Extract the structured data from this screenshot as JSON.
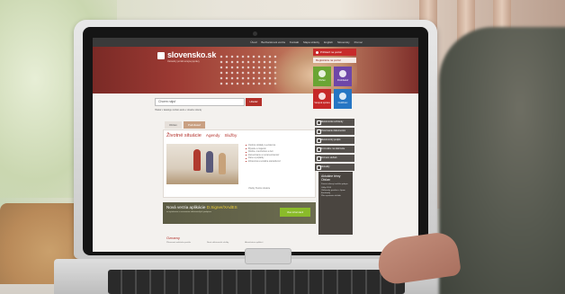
{
  "site": {
    "top_nav": [
      "Úvod",
      "Bezbariérová verzia",
      "Kontakt",
      "Mapa stránky",
      "English",
      "Slovensky",
      "Pomoc"
    ],
    "logo": {
      "name": "slovensko.sk",
      "tagline": "Ústredný portál verejnej správy"
    },
    "login_label": "Prihlásiť na portál",
    "register_label": "Registrácia na portál",
    "tiles": [
      {
        "label": "Občan",
        "color": "#6aa534"
      },
      {
        "label": "Podnikateľ",
        "color": "#6e46a8"
      },
      {
        "label": "Verejná správa",
        "color": "#c62828"
      },
      {
        "label": "Cudzinec",
        "color": "#2676c4"
      }
    ],
    "search": {
      "placeholder": "Chcem nájsť",
      "button": "Hľadať",
      "sub": "Hľadať v katalógu služieb alebo v obsahu stránky"
    },
    "tabs": [
      "Občan",
      "Podnikateľ"
    ],
    "headline": [
      "Životné situácie",
      "Agendy",
      "Služby"
    ],
    "life_situations": [
      "Osobné doklady a evidencia",
      "Bývanie a majetok",
      "Rodina, manželstvo a deti",
      "Zamestnanie a nezamestnanosť",
      "Dane a poplatky",
      "Zdravotná a sociálna starostlivosť"
    ],
    "life_more": "Všetky životné situácie",
    "side_links": [
      "Elektronické schránky",
      "Overovanie dokumentov",
      "Elektronický podpis",
      "Formuláre na stiahnutie",
      "Zoznam služieb",
      "Aktuality"
    ],
    "news_box": {
      "title": "Aktuálne témy Občan",
      "items": [
        "Zmena adresy trvalého pobytu",
        "Voľby 2014",
        "Občiansky preukaz s čipom",
        "Eurofondy",
        "Plán spustenia služieb"
      ]
    },
    "promo": {
      "title_prefix": "Nová verzia aplikácie",
      "title_highlight": "D.Signer/XAdES",
      "sub": "na vytváranie a overovanie elektronických podpisov",
      "button": "Viac informácií"
    },
    "news_section": {
      "title": "Oznamy",
      "items": [
        "Plánovaná odstávka portálu",
        "Nové elektronické služby",
        "Aktualizácia aplikácií"
      ]
    }
  }
}
